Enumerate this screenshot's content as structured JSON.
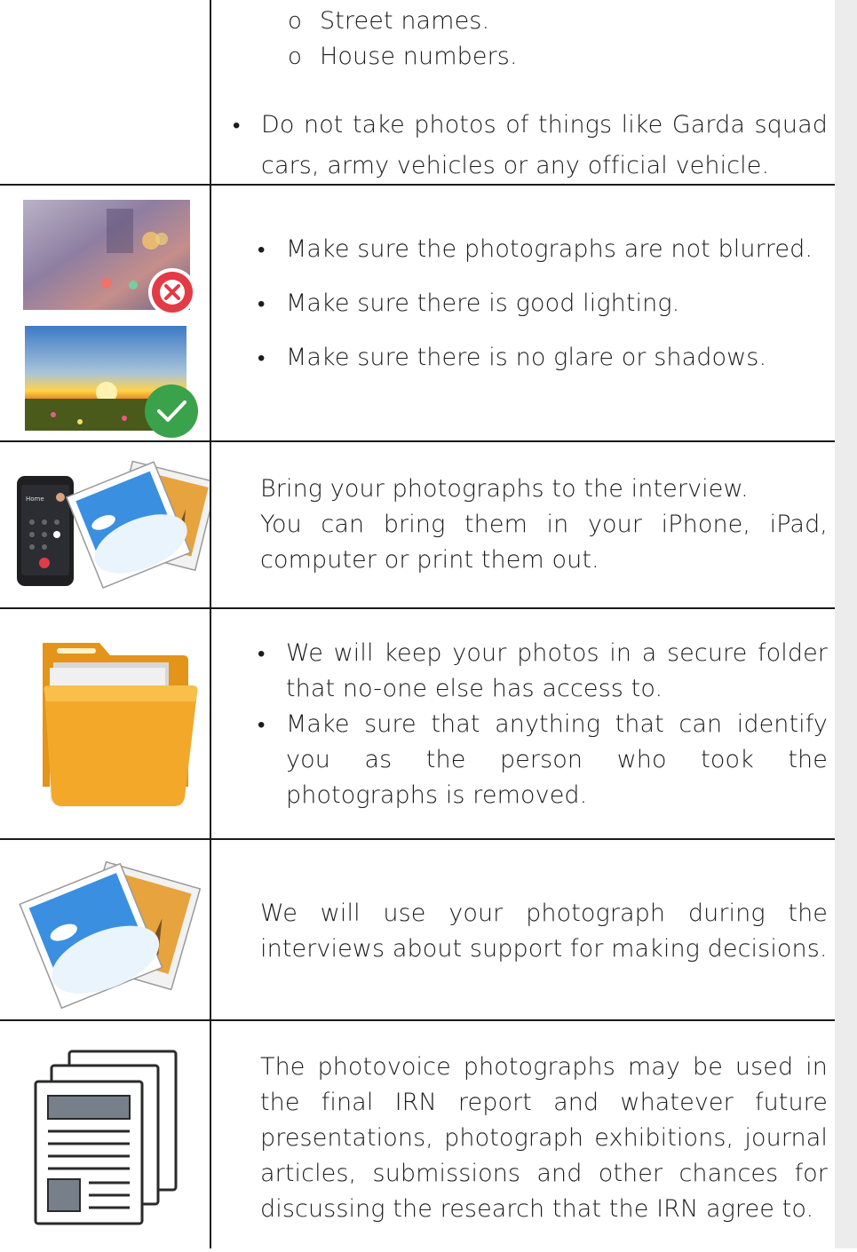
{
  "rows": {
    "r1": {
      "sub_items": [
        "Street names.",
        "House numbers."
      ],
      "bullet": "Do not take photos of things like Garda squad cars, army vehicles or any official vehicle."
    },
    "r2": {
      "icons": [
        "blurred-photo-icon",
        "cross-badge-icon",
        "sunset-photo-icon",
        "check-badge-icon"
      ],
      "bullets": [
        "Make sure the photographs are not blurred.",
        "Make sure there is good lighting.",
        "Make sure there is no glare or shadows."
      ]
    },
    "r3": {
      "icons": [
        "phone-icon",
        "photos-stack-icon"
      ],
      "line1": "Bring your photographs to the interview.",
      "line2": "You can bring them in your iPhone, iPad, computer or print them out."
    },
    "r4": {
      "icons": [
        "folder-icon"
      ],
      "bullets": [
        "We will keep your photos in a secure folder that no-one else has access to.",
        "Make sure that anything that can identify you as the person who took the photographs is removed."
      ]
    },
    "r5": {
      "icons": [
        "photos-stack-icon"
      ],
      "text": "We will use your photograph during the interviews about support for making decisions."
    },
    "r6": {
      "icons": [
        "documents-icon"
      ],
      "text": "The photovoice photographs may be used in the final IRN report and whatever future presentations, photograph exhibitions, journal articles, submissions and other chances for discussing the research that the IRN agree to."
    }
  },
  "colors": {
    "cross": "#e23b45",
    "check": "#3aa24a",
    "folder": "#f3a82a",
    "sky": "#3a8fe0"
  }
}
